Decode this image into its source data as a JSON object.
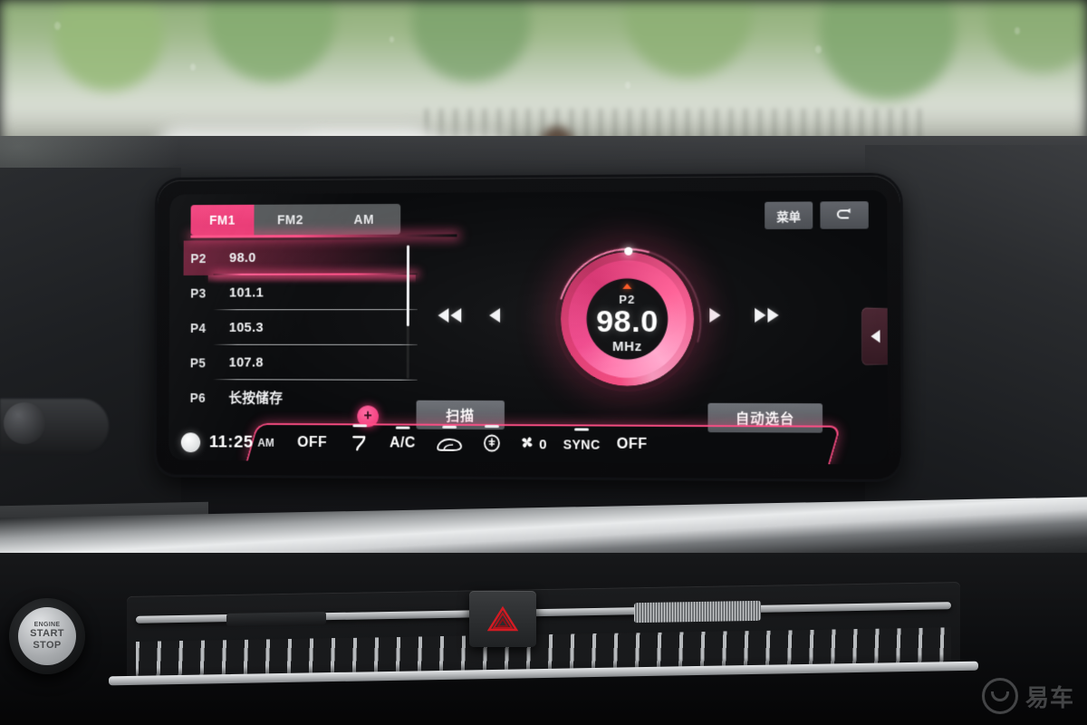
{
  "scene": {
    "device": "car-infotainment-screen",
    "watermark_text": "易车"
  },
  "screen": {
    "tabs": [
      {
        "label": "FM1",
        "active": true
      },
      {
        "label": "FM2",
        "active": false
      },
      {
        "label": "AM",
        "active": false
      }
    ],
    "top_right": {
      "menu_label": "菜单",
      "back_icon": "back-arrow-icon"
    },
    "presets": {
      "rows": [
        {
          "slot": "P2",
          "value": "98.0",
          "selected": true
        },
        {
          "slot": "P3",
          "value": "101.1",
          "selected": false
        },
        {
          "slot": "P4",
          "value": "105.3",
          "selected": false
        },
        {
          "slot": "P5",
          "value": "107.8",
          "selected": false
        },
        {
          "slot": "P6",
          "value": "长按储存",
          "selected": false
        }
      ],
      "add_label": "+"
    },
    "transport": {
      "rewind_fast_icon": "rewind-fast-icon",
      "prev_icon": "previous-icon",
      "next_icon": "next-icon",
      "forward_fast_icon": "forward-fast-icon"
    },
    "dial": {
      "preset_label": "P2",
      "frequency": "98.0",
      "unit": "MHz",
      "accent_color": "#ff4e86",
      "marker_color": "#ff5722"
    },
    "actions": {
      "scan_label": "扫描",
      "auto_tune_label": "自动选台"
    },
    "drawer": {
      "icon": "drawer-left-arrow-icon"
    },
    "climate": {
      "clock": "11:25",
      "meridiem": "AM",
      "left_temp": "OFF",
      "right_temp": "OFF",
      "ac_label": "A/C",
      "sync_label": "SYNC",
      "fan_level": "0",
      "icons": [
        "driver-seat-circle-icon",
        "airflow-face-icon",
        "ac-icon",
        "rear-defrost-icon",
        "front-defrost-icon",
        "fan-icon"
      ]
    }
  },
  "console": {
    "start_stop": {
      "line1": "ENGINE",
      "line2": "START",
      "line3": "STOP"
    },
    "hazard_icon": "hazard-triangle-icon"
  }
}
